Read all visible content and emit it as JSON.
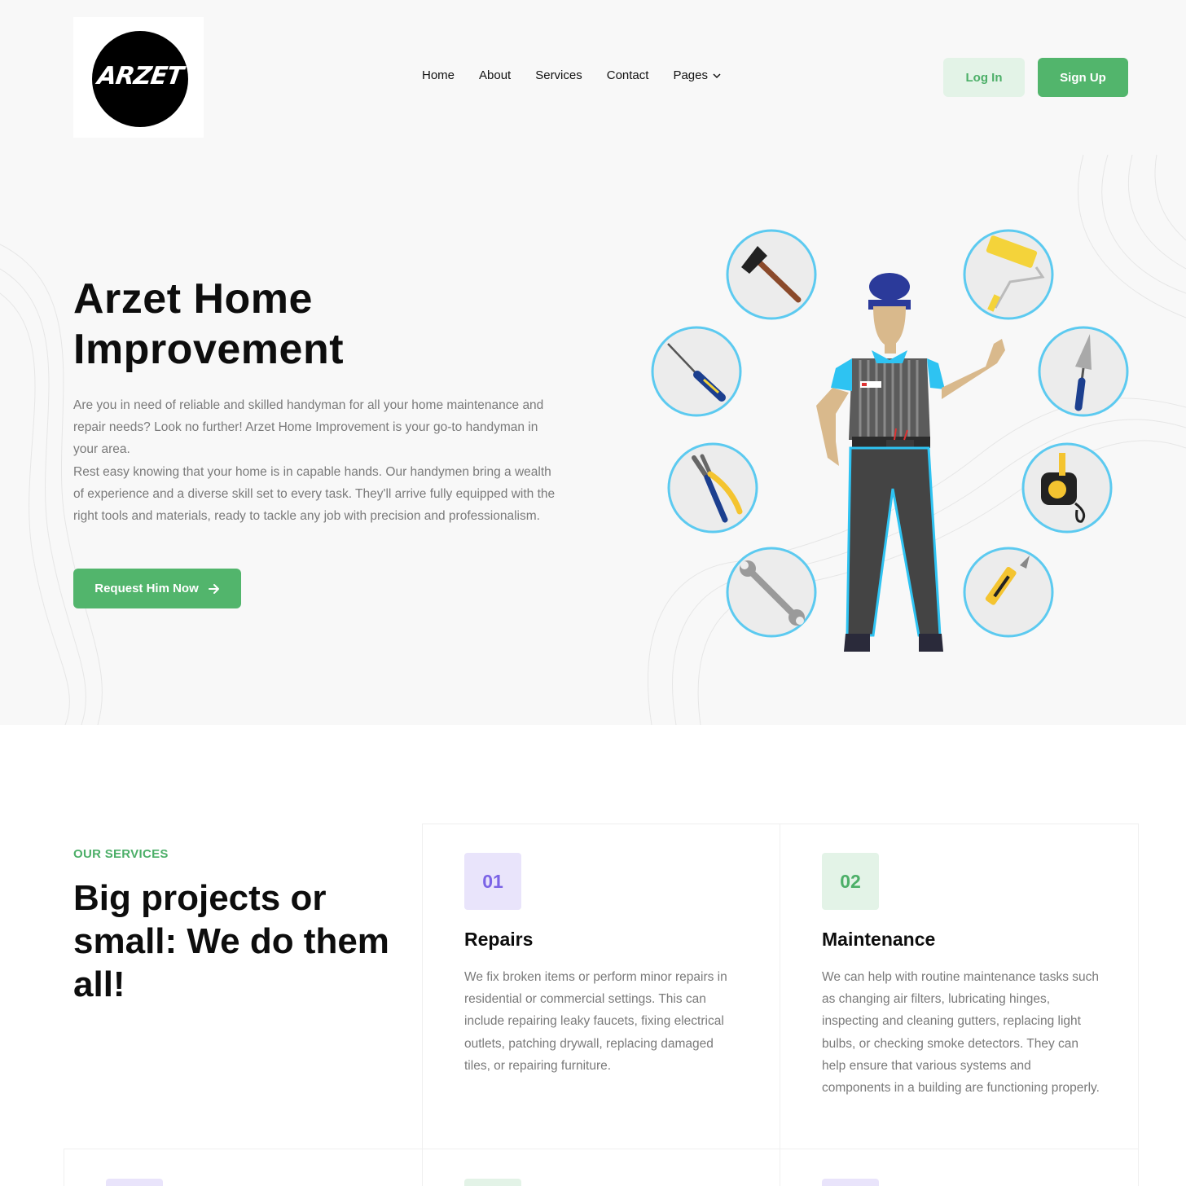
{
  "brand": {
    "logo_text": "ARZET"
  },
  "nav": {
    "items": [
      {
        "label": "Home"
      },
      {
        "label": "About"
      },
      {
        "label": "Services"
      },
      {
        "label": "Contact"
      },
      {
        "label": "Pages"
      }
    ]
  },
  "auth": {
    "login_label": "Log In",
    "signup_label": "Sign Up"
  },
  "hero": {
    "title": "Arzet Home Improvement",
    "paragraph1": "Are you in need of reliable and skilled handyman for all your home maintenance and repair needs? Look no further! Arzet Home Improvement is your go-to handyman in your area.",
    "paragraph2": "Rest easy knowing that your home is in capable hands. Our handymen bring a wealth of experience and a diverse skill set to every task. They'll arrive fully equipped with the right tools and materials, ready to tackle any job with precision and professionalism.",
    "cta_label": "Request Him Now"
  },
  "services": {
    "label": "OUR SERVICES",
    "title": "Big projects or small: We do them all!",
    "cards": [
      {
        "number": "01",
        "title": "Repairs",
        "text": "We fix broken items or perform minor repairs in residential or commercial settings. This can include repairing leaky faucets, fixing electrical outlets, patching drywall, replacing damaged tiles, or repairing furniture."
      },
      {
        "number": "02",
        "title": "Maintenance",
        "text": "We can help with routine maintenance tasks such as changing air filters, lubricating hinges, inspecting and cleaning gutters, replacing light bulbs, or checking smoke detectors. They can help ensure that various systems and components in a building are functioning properly."
      }
    ]
  },
  "colors": {
    "accent": "#52b56c",
    "accent_light": "#e3f3e7",
    "purple_badge_bg": "#e9e4fb",
    "purple_badge_text": "#7b63e6",
    "green_badge_bg": "#e3f3e7",
    "green_badge_text": "#4caf68",
    "tool_circle_border": "#5ccaf0"
  },
  "icons": {
    "tools": [
      "hammer-icon",
      "paint-roller-icon",
      "screwdriver-icon",
      "trowel-icon",
      "pliers-icon",
      "tape-measure-icon",
      "wrench-icon",
      "utility-knife-icon"
    ]
  }
}
